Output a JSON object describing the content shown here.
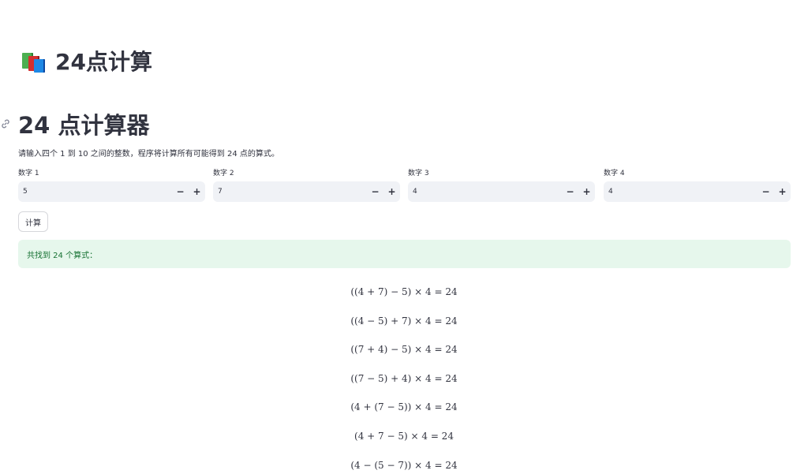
{
  "app": {
    "title": "24点计算"
  },
  "section": {
    "title": "24 点计算器",
    "description": "请输入四个 1 到 10 之间的整数，程序将计算所有可能得到 24 点的算式。"
  },
  "inputs": [
    {
      "label": "数字 1",
      "value": "5",
      "minus": "−",
      "plus": "+"
    },
    {
      "label": "数字 2",
      "value": "7",
      "minus": "−",
      "plus": "+"
    },
    {
      "label": "数字 3",
      "value": "4",
      "minus": "−",
      "plus": "+"
    },
    {
      "label": "数字 4",
      "value": "4",
      "minus": "−",
      "plus": "+"
    }
  ],
  "calculate_button": {
    "label": "计算"
  },
  "result": {
    "summary": "共找到 24 个算式："
  },
  "formulas": [
    "((4 + 7) − 5) × 4 = 24",
    "((4 − 5) + 7) × 4 = 24",
    "((7 + 4) − 5) × 4 = 24",
    "((7 − 5) + 4) × 4 = 24",
    "(4 + (7 − 5)) × 4 = 24",
    "(4 + 7 − 5) × 4 = 24",
    "(4 − (5 − 7)) × 4 = 24"
  ],
  "icons": {
    "app_icon": "books-icon",
    "anchor_icon": "link-icon",
    "books_colors": [
      "#4caf50",
      "#d32f2f",
      "#1e88e5"
    ]
  },
  "colors": {
    "success_background": "#e6f7ec",
    "success_text": "#177233",
    "input_background": "#f0f2f6"
  }
}
